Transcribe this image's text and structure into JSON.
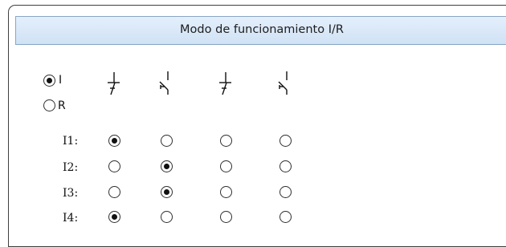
{
  "window": {
    "title": "Modo de funcionamiento I/R"
  },
  "mode": {
    "options": [
      {
        "label": "I",
        "selected": true
      },
      {
        "label": "R",
        "selected": false
      }
    ]
  },
  "symbols": [
    "contact-closed-icon",
    "contact-open-icon",
    "contact-closed-icon",
    "contact-open-icon"
  ],
  "grid": {
    "rows": [
      {
        "label": "I1:",
        "selected_index": 0
      },
      {
        "label": "I2:",
        "selected_index": 1
      },
      {
        "label": "I3:",
        "selected_index": 1
      },
      {
        "label": "I4:",
        "selected_index": 0
      }
    ]
  }
}
